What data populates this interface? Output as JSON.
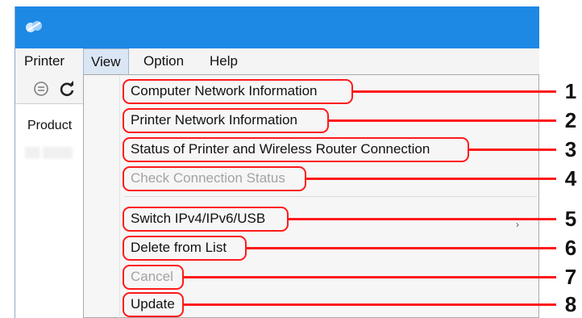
{
  "menubar": {
    "items": [
      {
        "label": "Printer"
      },
      {
        "label": "View"
      },
      {
        "label": "Option"
      },
      {
        "label": "Help"
      }
    ]
  },
  "left_pane": {
    "column_header": "Product"
  },
  "view_menu": {
    "items": [
      {
        "label": "Computer Network Information",
        "enabled": true,
        "callout": "1"
      },
      {
        "label": "Printer Network Information",
        "enabled": true,
        "callout": "2"
      },
      {
        "label": "Status of Printer and Wireless Router Connection",
        "enabled": true,
        "callout": "3"
      },
      {
        "label": "Check Connection Status",
        "enabled": false,
        "callout": "4"
      },
      {
        "label": "Switch IPv4/IPv6/USB",
        "enabled": true,
        "callout": "5"
      },
      {
        "label": "Delete from List",
        "enabled": true,
        "callout": "6"
      },
      {
        "label": "Cancel",
        "enabled": false,
        "callout": "7"
      },
      {
        "label": "Update",
        "enabled": true,
        "callout": "8"
      }
    ]
  },
  "colors": {
    "title_bar": "#1e88e5",
    "callout": "#ff1a1a",
    "disabled_text": "#a3a3a3"
  }
}
